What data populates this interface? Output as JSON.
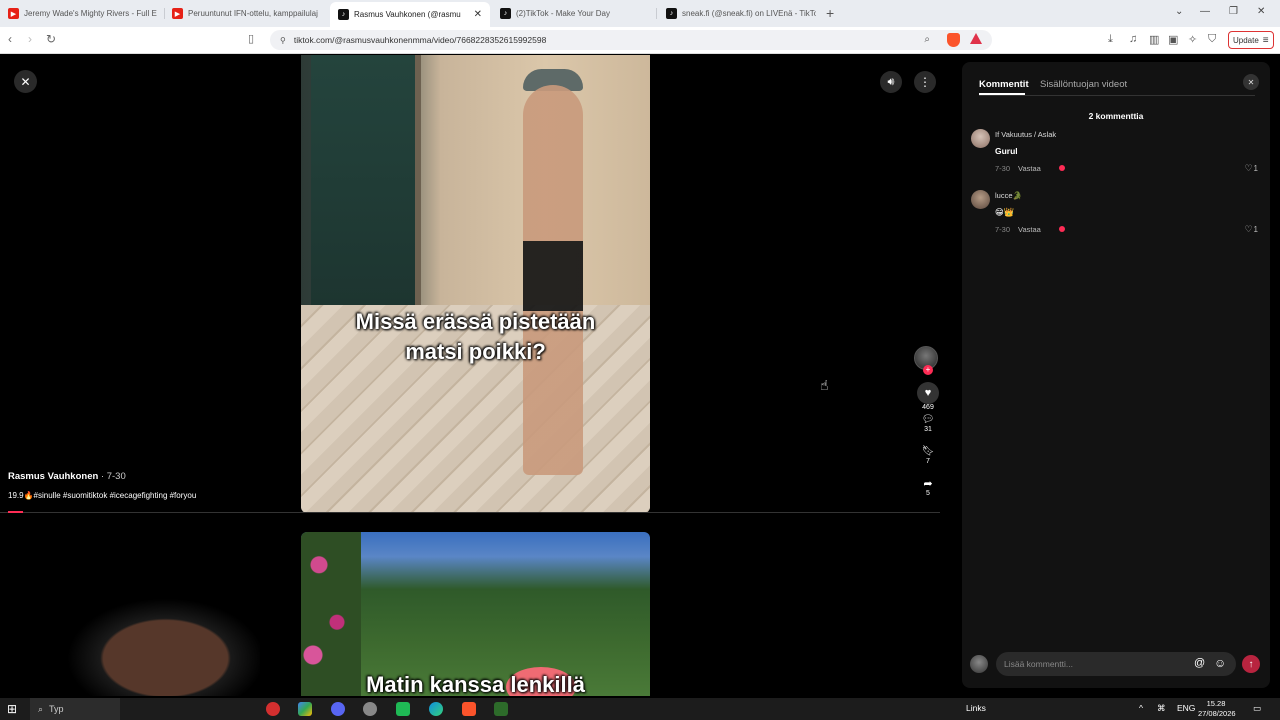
{
  "browser": {
    "tabs": [
      {
        "title": "Jeremy Wade's Mighty Rivers - Full E",
        "icon": "youtube-icon"
      },
      {
        "title": "Peruuntunut IFN-ottelu, kamppailulaj",
        "icon": "youtube-icon"
      },
      {
        "title": "Rasmus Vauhkonen (@rasmu",
        "icon": "tiktok-icon",
        "active": true
      },
      {
        "title": "(2)TikTok - Make Your Day",
        "icon": "tiktok-icon"
      },
      {
        "title": "sneak.fi (@sneak.fi) on LIVEnä - TikTo",
        "icon": "tiktok-icon"
      }
    ],
    "url": "tiktok.com/@rasmusvauhkonenmma/video/7668228352615992598",
    "update_label": "Update"
  },
  "video": {
    "caption1_line1": "Missä erässä pistetään",
    "caption1_line2": "matsi poikki?",
    "caption2": "Matin kanssa lenkillä",
    "creator_name": "Rasmus Vauhkonen",
    "creator_date": "7-30",
    "description": "19.9🔥#sinulle #suomitiktok #icecagefighting #foryou",
    "likes": "469",
    "comments": "31",
    "saves": "7",
    "shares": "5"
  },
  "panel": {
    "tab_comments": "Kommentit",
    "tab_creator_videos": "Sisällöntuojan videot",
    "comment_count": "2 kommenttia",
    "comments": [
      {
        "author": "If Vakuutus / Aslak",
        "text": "Gurul",
        "date": "7-30",
        "reply": "Vastaa",
        "likes": "1"
      },
      {
        "author": "lucce🐊",
        "text": "😁👑",
        "date": "7-30",
        "reply": "Vastaa",
        "likes": "1"
      }
    ],
    "input_placeholder": "Lisää kommentti..."
  },
  "taskbar": {
    "search": "Typ",
    "links": "Links",
    "lang": "ENG",
    "time": "15.28",
    "date": "27/08/2026"
  },
  "colors": {
    "accent": "#fe2c55",
    "panel_bg": "#121212"
  }
}
